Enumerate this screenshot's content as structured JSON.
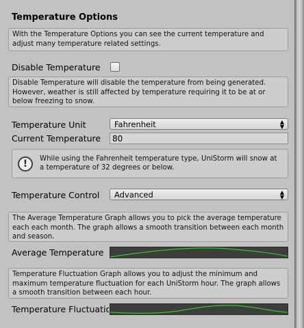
{
  "section": {
    "title": "Temperature Options",
    "intro_help": "With the Temperature Options you can see the current temperature and adjust many temperature related settings."
  },
  "disable_temperature": {
    "label": "Disable Temperature",
    "checked": false,
    "help": "Disable Temperature will disable the temperature from being generated. However, weather is still affected by temperature requiring it to be at or below freezing to snow."
  },
  "temperature_unit": {
    "label": "Temperature Unit",
    "selected": "Fahrenheit"
  },
  "current_temperature": {
    "label": "Current Temperature",
    "value": "80"
  },
  "info_message": "While using the Fahrenheit temperature type, UniStorm will snow at a temperature of 32 degrees or below.",
  "temperature_control": {
    "label": "Temperature Control",
    "selected": "Advanced"
  },
  "average_temperature": {
    "help": "The Average Temperature Graph allows you to pick the average temperature each each month. The graph allows a smooth transition between each month and season.",
    "label": "Average Temperature",
    "curve_color": "#27d11a"
  },
  "temperature_fluctuation": {
    "help": "Temperature Fluctuation Graph allows you to adjust the minimum and maximum temperature fluctuation for each UniStorm hour. The graph allows a smooth transition between each hour.",
    "label": "Temperature Fluctuation",
    "curve_color": "#27d11a"
  }
}
